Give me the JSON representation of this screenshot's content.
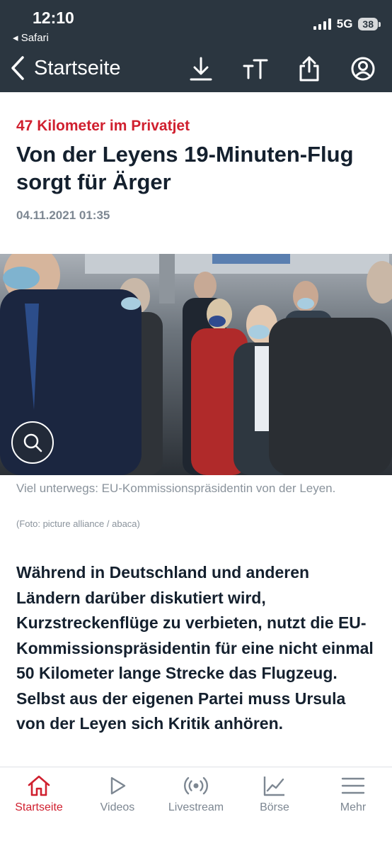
{
  "status": {
    "time": "12:10",
    "back_app": "◂ Safari",
    "network": "5G",
    "battery": "38"
  },
  "nav": {
    "back_label": "Startseite",
    "icons": [
      "download-icon",
      "text-size-icon",
      "share-icon",
      "account-icon"
    ]
  },
  "article": {
    "kicker": "47 Kilometer im Privatjet",
    "headline": "Von der Leyens 19-Minuten-Flug sorgt für Ärger",
    "date": "04.11.2021 01:35",
    "caption": "Viel unterwegs: EU-Kommissionspräsidentin von der Leyen.",
    "credit": "(Foto: picture alliance / abaca)",
    "lead": "Während in Deutschland und anderen Ländern darüber diskutiert wird, Kurzstreckenflüge zu verbieten, nutzt die EU-Kommissionspräsidentin für eine nicht einmal 50 Kilometer lange Strecke das Flugzeug. Selbst aus der eigenen Partei muss Ursula von der Leyen sich Kritik anhören."
  },
  "tabs": [
    {
      "label": "Startseite",
      "icon": "home-icon",
      "active": true
    },
    {
      "label": "Videos",
      "icon": "play-icon",
      "active": false
    },
    {
      "label": "Livestream",
      "icon": "broadcast-icon",
      "active": false
    },
    {
      "label": "Börse",
      "icon": "chart-icon",
      "active": false
    },
    {
      "label": "Mehr",
      "icon": "menu-icon",
      "active": false
    }
  ],
  "colors": {
    "accent": "#d0202f",
    "header_bg": "#2b3640",
    "text": "#14202e",
    "muted": "#7d8792"
  }
}
